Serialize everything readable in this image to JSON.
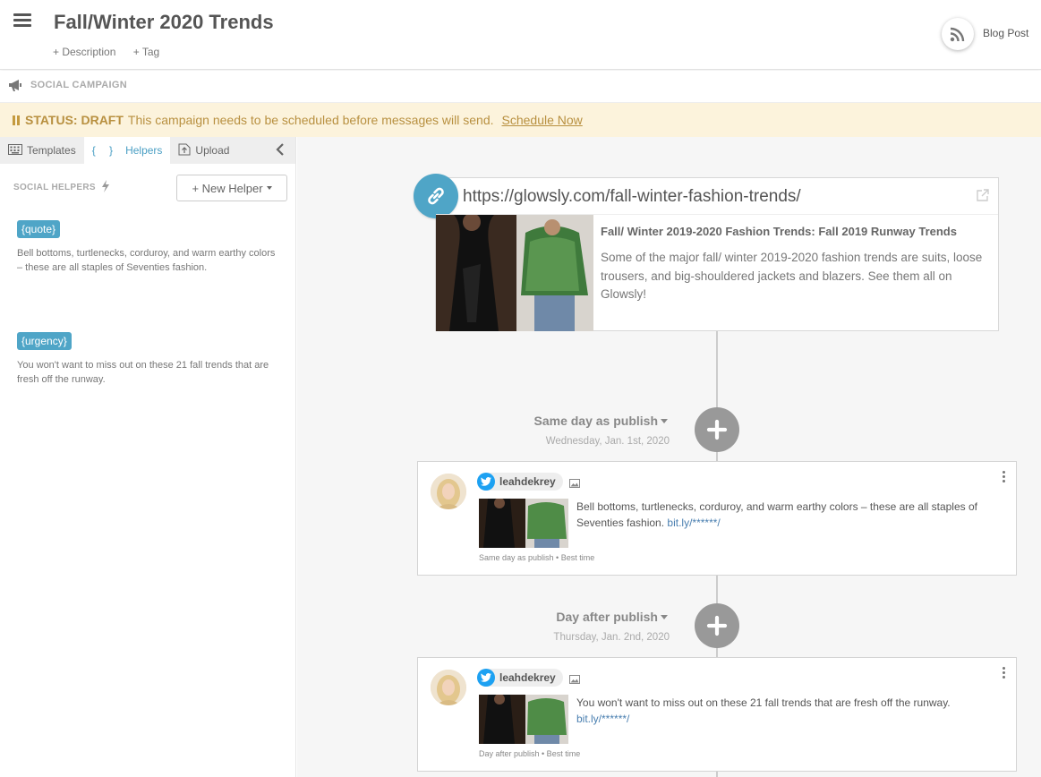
{
  "header": {
    "title": "Fall/Winter 2020 Trends",
    "description_link": "+ Description",
    "tag_link": "+ Tag",
    "type_label": "Blog Post"
  },
  "section": {
    "label": "SOCIAL CAMPAIGN"
  },
  "status": {
    "label": "STATUS: DRAFT",
    "message": "This campaign needs to be scheduled before messages will send.",
    "action": "Schedule Now"
  },
  "sidebar": {
    "tabs": [
      {
        "label": "Templates"
      },
      {
        "label": "Helpers",
        "prefix": "{ }"
      },
      {
        "label": "Upload"
      }
    ],
    "heading": "SOCIAL HELPERS",
    "new_helper_label": "+ New Helper",
    "helpers": [
      {
        "tag": "{quote}",
        "text": "Bell bottoms, turtlenecks, corduroy, and warm earthy colors – these are all staples of Seventies fashion."
      },
      {
        "tag": "{urgency}",
        "text": "You won't want to miss out on these 21 fall trends that are fresh off the runway."
      }
    ]
  },
  "link_card": {
    "url": "https://glowsly.com/fall-winter-fashion-trends/",
    "title": "Fall/ Winter 2019-2020 Fashion Trends: Fall 2019 Runway Trends",
    "description": "Some of the major fall/ winter 2019-2020 fashion trends are suits, loose trousers, and big-shouldered jackets and blazers. See them all on Glowsly!"
  },
  "schedule": [
    {
      "day": "Same day as publish",
      "date": "Wednesday, Jan. 1st, 2020",
      "post": {
        "account": "leahdekrey",
        "text": "Bell bottoms, turtlenecks, corduroy, and warm earthy colors – these are all staples of Seventies fashion.",
        "short_link": "bit.ly/******/",
        "meta": "Same day as publish • Best time"
      }
    },
    {
      "day": "Day after publish",
      "date": "Thursday, Jan. 2nd, 2020",
      "post": {
        "account": "leahdekrey",
        "text": "You won't want to miss out on these 21 fall trends that are fresh off the runway.",
        "short_link": "bit.ly/******/",
        "meta": "Day after publish • Best time"
      }
    }
  ],
  "colors": {
    "accent": "#4fa5c7",
    "status_bg": "#fcf3dc",
    "status_text": "#b89040",
    "twitter": "#1da1f2"
  }
}
